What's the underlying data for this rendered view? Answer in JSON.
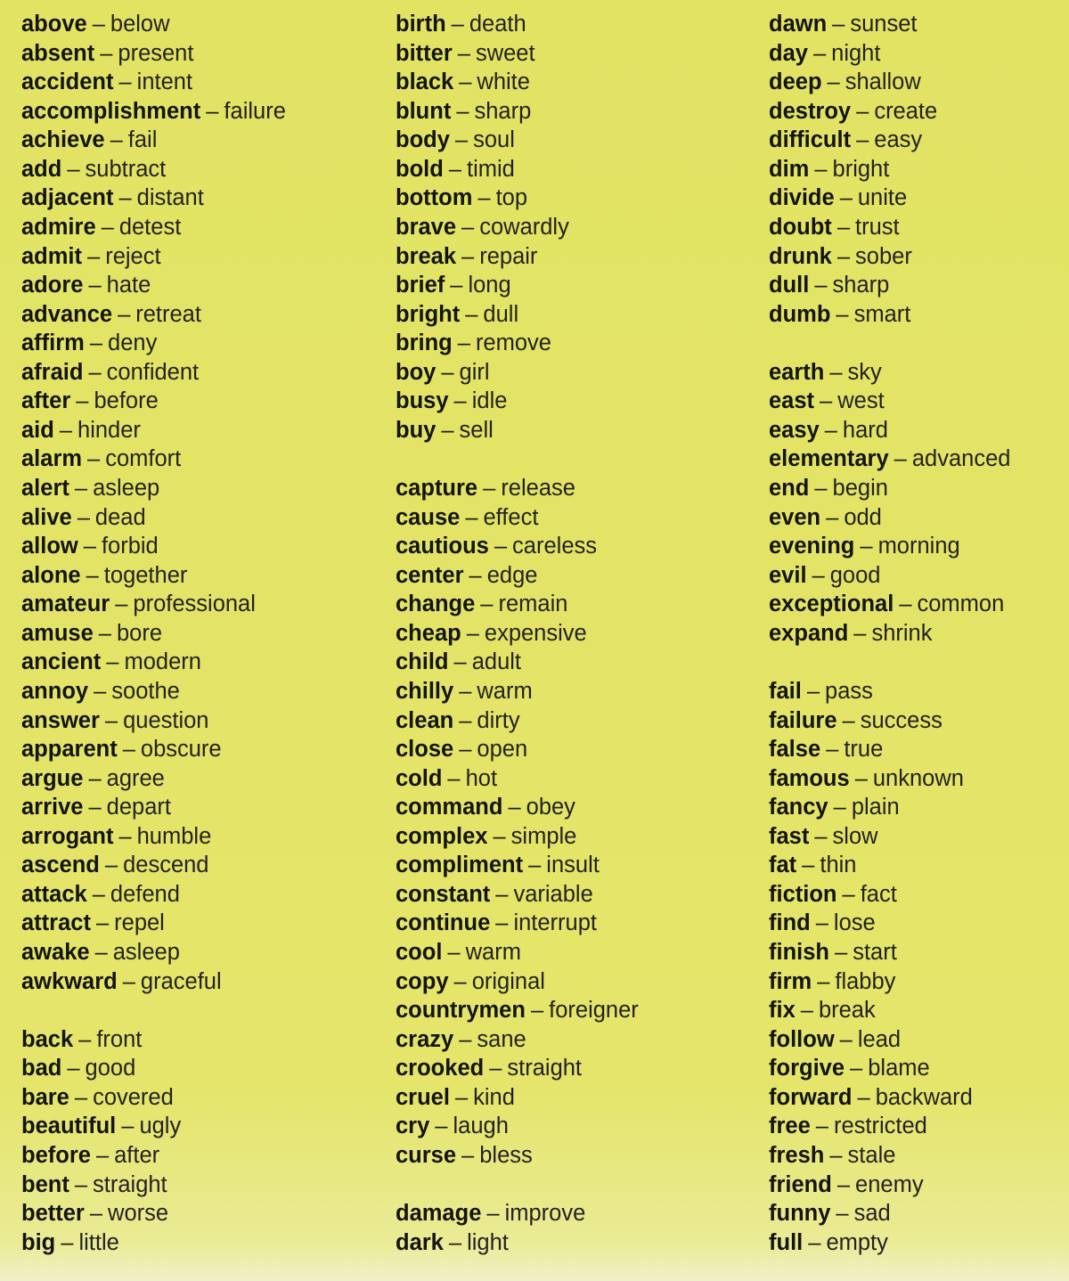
{
  "background_color": "#e3e46a",
  "columns": [
    [
      [
        "above",
        "below"
      ],
      [
        "absent",
        "present"
      ],
      [
        "accident",
        "intent"
      ],
      [
        "accomplishment",
        "failure"
      ],
      [
        "achieve",
        "fail"
      ],
      [
        "add",
        "subtract"
      ],
      [
        "adjacent",
        "distant"
      ],
      [
        "admire",
        "detest"
      ],
      [
        "admit",
        "reject"
      ],
      [
        "adore",
        "hate"
      ],
      [
        "advance",
        "retreat"
      ],
      [
        "affirm",
        "deny"
      ],
      [
        "afraid",
        "confident"
      ],
      [
        "after",
        "before"
      ],
      [
        "aid",
        "hinder"
      ],
      [
        "alarm",
        "comfort"
      ],
      [
        "alert",
        "asleep"
      ],
      [
        "alive",
        "dead"
      ],
      [
        "allow",
        "forbid"
      ],
      [
        "alone",
        "together"
      ],
      [
        "amateur",
        "professional"
      ],
      [
        "amuse",
        "bore"
      ],
      [
        "ancient",
        "modern"
      ],
      [
        "annoy",
        "soothe"
      ],
      [
        "answer",
        "question"
      ],
      [
        "apparent",
        "obscure"
      ],
      [
        "argue",
        "agree"
      ],
      [
        "arrive",
        "depart"
      ],
      [
        "arrogant",
        "humble"
      ],
      [
        "ascend",
        "descend"
      ],
      [
        "attack",
        "defend"
      ],
      [
        "attract",
        "repel"
      ],
      [
        "awake",
        "asleep"
      ],
      [
        "awkward",
        "graceful"
      ],
      null,
      [
        "back",
        "front"
      ],
      [
        "bad",
        "good"
      ],
      [
        "bare",
        "covered"
      ],
      [
        "beautiful",
        "ugly"
      ],
      [
        "before",
        "after"
      ],
      [
        "bent",
        "straight"
      ],
      [
        "better",
        "worse"
      ],
      [
        "big",
        "little"
      ]
    ],
    [
      [
        "birth",
        "death"
      ],
      [
        "bitter",
        "sweet"
      ],
      [
        "black",
        "white"
      ],
      [
        "blunt",
        "sharp"
      ],
      [
        "body",
        "soul"
      ],
      [
        "bold",
        "timid"
      ],
      [
        "bottom",
        "top"
      ],
      [
        "brave",
        "cowardly"
      ],
      [
        "break",
        "repair"
      ],
      [
        "brief",
        "long"
      ],
      [
        "bright",
        "dull"
      ],
      [
        "bring",
        "remove"
      ],
      [
        "boy",
        "girl"
      ],
      [
        "busy",
        "idle"
      ],
      [
        "buy",
        "sell"
      ],
      null,
      [
        "capture",
        "release"
      ],
      [
        "cause",
        "effect"
      ],
      [
        "cautious",
        "careless"
      ],
      [
        "center",
        "edge"
      ],
      [
        "change",
        "remain"
      ],
      [
        "cheap",
        "expensive"
      ],
      [
        "child",
        "adult"
      ],
      [
        "chilly",
        "warm"
      ],
      [
        "clean",
        "dirty"
      ],
      [
        "close",
        "open"
      ],
      [
        "cold",
        "hot"
      ],
      [
        "command",
        "obey"
      ],
      [
        "complex",
        "simple"
      ],
      [
        "compliment",
        "insult"
      ],
      [
        "constant",
        "variable"
      ],
      [
        "continue",
        "interrupt"
      ],
      [
        "cool",
        "warm"
      ],
      [
        "copy",
        "original"
      ],
      [
        "countrymen",
        "foreigner"
      ],
      [
        "crazy",
        "sane"
      ],
      [
        "crooked",
        "straight"
      ],
      [
        "cruel",
        "kind"
      ],
      [
        "cry",
        "laugh"
      ],
      [
        "curse",
        "bless"
      ],
      null,
      [
        "damage",
        "improve"
      ],
      [
        "dark",
        "light"
      ]
    ],
    [
      [
        "dawn",
        "sunset"
      ],
      [
        "day",
        "night"
      ],
      [
        "deep",
        "shallow"
      ],
      [
        "destroy",
        "create"
      ],
      [
        "difficult",
        "easy"
      ],
      [
        "dim",
        "bright"
      ],
      [
        "divide",
        "unite"
      ],
      [
        "doubt",
        "trust"
      ],
      [
        "drunk",
        "sober"
      ],
      [
        "dull",
        "sharp"
      ],
      [
        "dumb",
        "smart"
      ],
      null,
      [
        "earth",
        "sky"
      ],
      [
        "east",
        "west"
      ],
      [
        "easy",
        "hard"
      ],
      [
        "elementary",
        "advanced"
      ],
      [
        "end",
        "begin"
      ],
      [
        "even",
        "odd"
      ],
      [
        "evening",
        "morning"
      ],
      [
        "evil",
        "good"
      ],
      [
        "exceptional",
        "common"
      ],
      [
        "expand",
        "shrink"
      ],
      null,
      [
        "fail",
        "pass"
      ],
      [
        "failure",
        "success"
      ],
      [
        "false",
        "true"
      ],
      [
        "famous",
        "unknown"
      ],
      [
        "fancy",
        "plain"
      ],
      [
        "fast",
        "slow"
      ],
      [
        "fat",
        "thin"
      ],
      [
        "fiction",
        "fact"
      ],
      [
        "find",
        "lose"
      ],
      [
        "finish",
        "start"
      ],
      [
        "firm",
        "flabby"
      ],
      [
        "fix",
        "break"
      ],
      [
        "follow",
        "lead"
      ],
      [
        "forgive",
        "blame"
      ],
      [
        "forward",
        "backward"
      ],
      [
        "free",
        "restricted"
      ],
      [
        "fresh",
        "stale"
      ],
      [
        "friend",
        "enemy"
      ],
      [
        "funny",
        "sad"
      ],
      [
        "full",
        "empty"
      ]
    ]
  ],
  "separator": "–"
}
